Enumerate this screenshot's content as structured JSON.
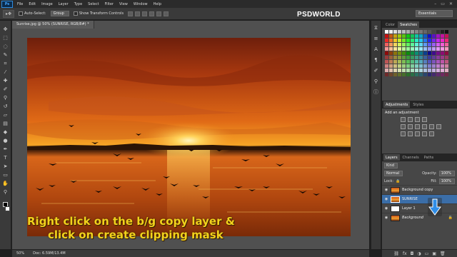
{
  "menubar": {
    "logo": "Ps",
    "items": [
      "File",
      "Edit",
      "Image",
      "Layer",
      "Type",
      "Select",
      "Filter",
      "View",
      "Window",
      "Help"
    ],
    "controls": [
      "–",
      "▭",
      "✕"
    ]
  },
  "options": {
    "auto_select_label": "Auto-Select:",
    "auto_select_value": "Group",
    "transform_label": "Show Transform Controls",
    "workspace": "Essentials"
  },
  "brand": "PSDWORLD",
  "document": {
    "tab_title": "Sunrise.jpg @ 50% (SUNRISE, RGB/8#) *",
    "zoom": "50%",
    "doc_size": "Doc: 6.59M/13.4M"
  },
  "caption": {
    "line1": "Right click on the b/g copy layer &",
    "line2": "click on create clipping mask"
  },
  "panels": {
    "top_tabs": [
      "Color",
      "Swatches"
    ],
    "adjust_tabs": [
      "Adjustments",
      "Styles"
    ],
    "adjust_title": "Add an adjustment",
    "layers_tabs": [
      "Layers",
      "Channels",
      "Paths"
    ],
    "kind_label": "Kind",
    "blend_mode": "Normal",
    "opacity_label": "Opacity:",
    "opacity_value": "100%",
    "lock_label": "Lock:",
    "fill_label": "Fill:",
    "fill_value": "100%",
    "layers": [
      {
        "name": "Background copy",
        "thumb": "sunset",
        "selected": false
      },
      {
        "name": "SUNRISE",
        "thumb": "sunset",
        "selected": true
      },
      {
        "name": "Layer 1",
        "thumb": "white",
        "selected": false
      },
      {
        "name": "Background",
        "thumb": "sunset",
        "selected": false
      }
    ]
  },
  "colors": {
    "accent": "#3b6ea8",
    "caption": "#f2d21c",
    "arrow": "#2f8ee8"
  }
}
